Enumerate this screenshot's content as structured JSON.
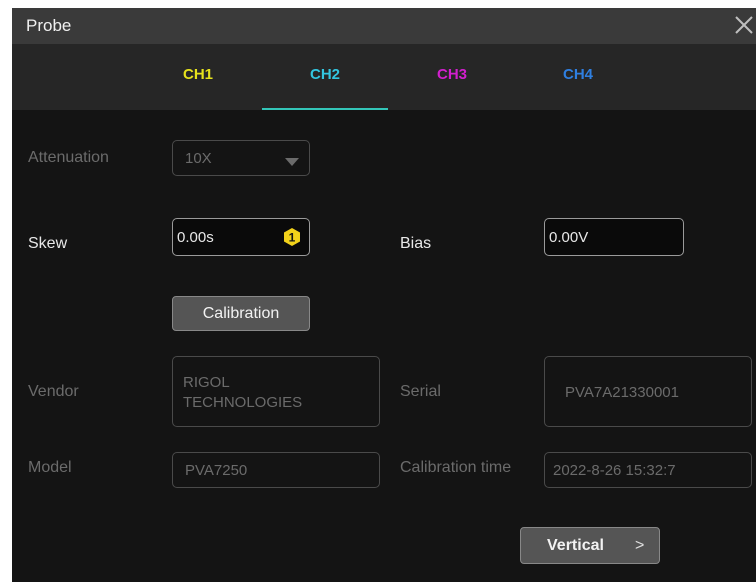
{
  "window": {
    "title": "Probe"
  },
  "tabs": [
    {
      "label": "CH1",
      "color": "#e6e21d"
    },
    {
      "label": "CH2",
      "color": "#33c6e0"
    },
    {
      "label": "CH3",
      "color": "#d21fce"
    },
    {
      "label": "CH4",
      "color": "#2f7fe0"
    }
  ],
  "active_tab": "CH2",
  "attenuation": {
    "label": "Attenuation",
    "value": "10X"
  },
  "skew": {
    "label": "Skew",
    "value": "0.00s"
  },
  "bias": {
    "label": "Bias",
    "value": "0.00V"
  },
  "calibration_button": {
    "label": "Calibration"
  },
  "vendor": {
    "label": "Vendor",
    "value_line1": "RIGOL",
    "value_line2": "TECHNOLOGIES"
  },
  "serial": {
    "label": "Serial",
    "value": "PVA7A21330001"
  },
  "model": {
    "label": "Model",
    "value": "PVA7250"
  },
  "calibration_time": {
    "label": "Calibration time",
    "value": "2022-8-26 15:32:7"
  },
  "vertical_button": {
    "label": "Vertical",
    "chevron": ">"
  },
  "icons": {
    "close": "close-icon",
    "dropdown": "caret-down-icon",
    "skew_adjust": "knob-hexagon-icon"
  }
}
